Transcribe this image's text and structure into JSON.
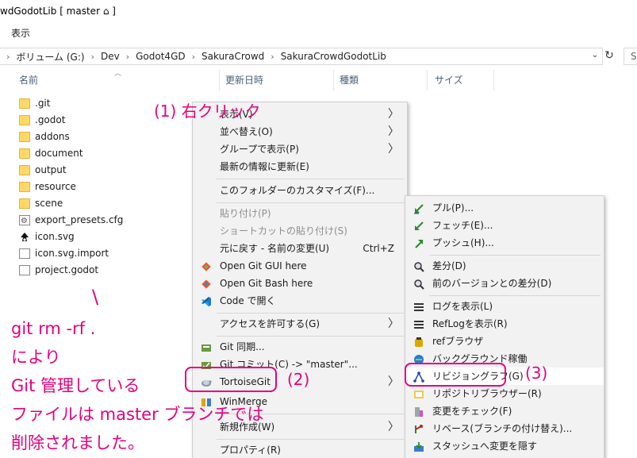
{
  "window": {
    "title": "wdGodotLib [ master ⌂ ]"
  },
  "menubar": {
    "view": "表示"
  },
  "address": {
    "segments": [
      "ボリューム (G:)",
      "Dev",
      "Godot4GD",
      "SakuraCrowd",
      "SakuraCrowdGodotLib"
    ],
    "search_hint": "S"
  },
  "columns": {
    "name": "名前",
    "modified": "更新日時",
    "type": "種類",
    "size": "サイズ"
  },
  "files": [
    {
      "name": ".git",
      "icon": "folder-icon"
    },
    {
      "name": ".godot",
      "icon": "folder-icon"
    },
    {
      "name": "addons",
      "icon": "folder-icon"
    },
    {
      "name": "document",
      "icon": "folder-icon"
    },
    {
      "name": "output",
      "icon": "folder-icon"
    },
    {
      "name": "resource",
      "icon": "folder-icon"
    },
    {
      "name": "scene",
      "icon": "folder-icon"
    },
    {
      "name": "export_presets.cfg",
      "icon": "config-file-icon"
    },
    {
      "name": "icon.svg",
      "icon": "inkscape-svg-icon"
    },
    {
      "name": "icon.svg.import",
      "icon": "file-icon"
    },
    {
      "name": "project.godot",
      "icon": "file-icon"
    }
  ],
  "context_menu": {
    "items": [
      {
        "label": "表示(V)",
        "submenu": true
      },
      {
        "label": "並べ替え(O)",
        "submenu": true
      },
      {
        "label": "グループで表示(P)",
        "submenu": true
      },
      {
        "label": "最新の情報に更新(E)"
      },
      {
        "label": "このフォルダーのカスタマイズ(F)..."
      },
      {
        "label": "貼り付け(P)",
        "disabled": true
      },
      {
        "label": "ショートカットの貼り付け(S)",
        "disabled": true
      },
      {
        "label": "元に戻す - 名前の変更(U)",
        "shortcut": "Ctrl+Z"
      },
      {
        "label": "Open Git GUI here",
        "icon": "git-gui-icon"
      },
      {
        "label": "Open Git Bash here",
        "icon": "git-bash-icon"
      },
      {
        "label": "Code で開く",
        "icon": "vscode-icon"
      },
      {
        "label": "アクセスを許可する(G)",
        "submenu": true
      },
      {
        "label": "Git 同期...",
        "icon": "git-sync-icon"
      },
      {
        "label": "Git コミット(C) -> \"master\"...",
        "icon": "git-commit-icon"
      },
      {
        "label": "TortoiseGit",
        "icon": "tortoisegit-icon",
        "submenu": true
      },
      {
        "label": "WinMerge",
        "icon": "winmerge-icon"
      },
      {
        "label": "新規作成(W)",
        "submenu": true
      },
      {
        "label": "プロパティ(R)"
      }
    ]
  },
  "tortoise_submenu": {
    "items": [
      {
        "label": "プル(P)...",
        "icon": "pull-icon"
      },
      {
        "label": "フェッチ(E)...",
        "icon": "fetch-icon"
      },
      {
        "label": "プッシュ(H)...",
        "icon": "push-icon"
      },
      {
        "label": "差分(D)",
        "icon": "diff-icon"
      },
      {
        "label": "前のバージョンとの差分(D)",
        "icon": "diff-prev-icon"
      },
      {
        "label": "ログを表示(L)",
        "icon": "log-icon"
      },
      {
        "label": "RefLogを表示(R)",
        "icon": "reflog-icon"
      },
      {
        "label": "refブラウザ",
        "icon": "ref-browser-icon"
      },
      {
        "label": "バックグラウンド稼働",
        "icon": "daemon-icon"
      },
      {
        "label": "リビジョングラフ(G)",
        "icon": "revision-graph-icon"
      },
      {
        "label": "リポジトリブラウザー(R)",
        "icon": "repo-browser-icon"
      },
      {
        "label": "変更をチェック(F)",
        "icon": "check-modifications-icon"
      },
      {
        "label": "リベース(ブランチの付け替え)...",
        "icon": "rebase-icon"
      },
      {
        "label": "スタッシュへ変更を隠す",
        "icon": "stash-icon"
      }
    ]
  },
  "annotations": {
    "step1": "(1) 右クリック",
    "step2": "(2)",
    "step3": "(3)",
    "backslash": "\\",
    "note_lines": [
      "git rm -rf .",
      "により",
      "Git 管理している",
      "ファイルは master ブランチでは",
      "削除されました。"
    ]
  },
  "colors": {
    "accent": "#e6007e",
    "menu_bg": "#f2f2f2",
    "folder": "#ffd866"
  }
}
